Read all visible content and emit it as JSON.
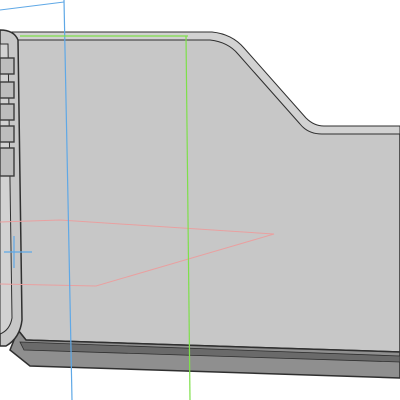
{
  "viewport": {
    "background": "#ffffff",
    "scene_type": "cad-3d-part-view"
  },
  "colors": {
    "part_face": "#c7c7c7",
    "part_face_light": "#d2d2d2",
    "part_edge": "#2f2f2f",
    "bevel_dark": "#6a6a6a",
    "bevel_mid": "#8f8f8f",
    "rib": "#3a3a3a",
    "rib_fill": "#bdbdbd",
    "plane_blue": "#5fa8e6",
    "plane_green": "#7ee04a",
    "sketch_red": "#e9a0a0"
  },
  "icons": {
    "triad": "coordinate-triad-icon"
  }
}
